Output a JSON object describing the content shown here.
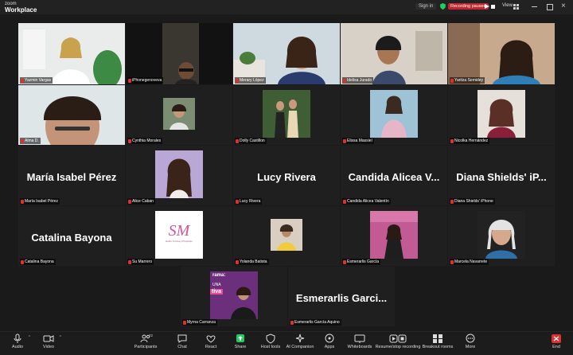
{
  "titlebar": {
    "brand_line1": "zoom",
    "brand_line2": "Workplace",
    "signin": "Sign in",
    "recording": "Recording paused",
    "view": "View"
  },
  "colors": {
    "active_speaker": "#1fce5e",
    "recording": "#c0262d",
    "muted_mic": "#e02f2f",
    "share": "#1fce5e",
    "end": "#e02f2f"
  },
  "participants": [
    {
      "name": "Yazmin Vargas",
      "video": true,
      "active": true
    },
    {
      "name": "iPhonegenoveva",
      "video": true
    },
    {
      "name": "Merary López",
      "video": true
    },
    {
      "name": "Idelisa Jurado",
      "video": true
    },
    {
      "name": "Yaritza Semidey",
      "video": true
    },
    {
      "name": "Alma D.",
      "video": true
    },
    {
      "name": "Cynthia Morales",
      "video": false,
      "avatar": true
    },
    {
      "name": "Dolly Castillon",
      "video": false,
      "avatar": true
    },
    {
      "name": "Elissa Massiel",
      "video": false,
      "avatar": true
    },
    {
      "name": "Nicolka Hernández",
      "video": false,
      "avatar": true
    },
    {
      "name": "María Isabel Pérez",
      "video": false,
      "display": "María Isabel Pérez"
    },
    {
      "name": "Alice Caban",
      "video": false,
      "avatar": true
    },
    {
      "name": "Lucy Rivera",
      "video": false,
      "display": "Lucy Rivera"
    },
    {
      "name": "Candida Alicea Valentín",
      "video": false,
      "display": "Candida Alicea V..."
    },
    {
      "name": "Diana Shields' iPhone",
      "video": false,
      "display": "Diana Shields' iP..."
    },
    {
      "name": "Catalina Bayona",
      "video": false,
      "display": "Catalina Bayona"
    },
    {
      "name": "Su Marrero",
      "video": false,
      "avatar": true,
      "logo_text": "SM",
      "logo_sub": "Estilo, Forma y Propósito"
    },
    {
      "name": "Yolanda Batista",
      "video": false,
      "avatar": true
    },
    {
      "name": "Esmerarlis García",
      "video": false,
      "avatar": true
    },
    {
      "name": "Marcela Navarrete",
      "video": false,
      "avatar": true
    },
    {
      "name": "Myrna Carranza",
      "video": false,
      "avatar": true,
      "flyer": [
        "rama:",
        "UNA",
        "tiva"
      ]
    },
    {
      "name": "Esmerarlis García Aquino",
      "video": false,
      "display": "Esmerarlis Garci..."
    }
  ],
  "toolbar": {
    "audio": "Audio",
    "video": "Video",
    "participants": "Participants",
    "participants_count": "22",
    "chat": "Chat",
    "react": "React",
    "share": "Share",
    "host_tools": "Host tools",
    "ai_companion": "AI Companion",
    "apps": "Apps",
    "whiteboards": "Whiteboards",
    "resume_stop": "Resume/stop recording",
    "breakout": "Breakout rooms",
    "more": "More",
    "end": "End"
  }
}
